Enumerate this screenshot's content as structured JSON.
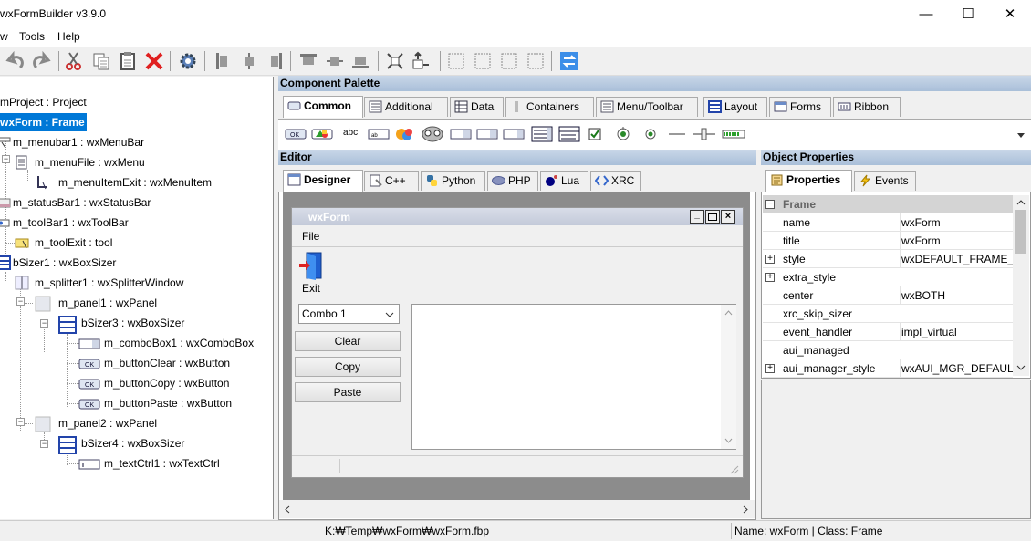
{
  "window": {
    "title": "wxFormBuilder v3.9.0",
    "minimize": "—",
    "maximize": "☐",
    "close": "✕"
  },
  "menubar": {
    "items": [
      "w",
      "Tools",
      "Help"
    ]
  },
  "tree": {
    "items": [
      {
        "label": "mProject : Project"
      },
      {
        "label": "wxForm : Frame"
      },
      {
        "label": "m_menubar1 : wxMenuBar"
      },
      {
        "label": "m_menuFile : wxMenu"
      },
      {
        "label": "m_menuItemExit : wxMenuItem"
      },
      {
        "label": "m_statusBar1 : wxStatusBar"
      },
      {
        "label": "m_toolBar1 : wxToolBar"
      },
      {
        "label": "m_toolExit : tool"
      },
      {
        "label": "bSizer1 : wxBoxSizer"
      },
      {
        "label": "m_splitter1 : wxSplitterWindow"
      },
      {
        "label": "m_panel1 : wxPanel"
      },
      {
        "label": "bSizer3 : wxBoxSizer"
      },
      {
        "label": "m_comboBox1 : wxComboBox"
      },
      {
        "label": "m_buttonClear : wxButton"
      },
      {
        "label": "m_buttonCopy : wxButton"
      },
      {
        "label": "m_buttonPaste : wxButton"
      },
      {
        "label": "m_panel2 : wxPanel"
      },
      {
        "label": "bSizer4 : wxBoxSizer"
      },
      {
        "label": "m_textCtrl1 : wxTextCtrl"
      }
    ]
  },
  "palette": {
    "title": "Component Palette",
    "tabs": [
      "Common",
      "Additional",
      "Data",
      "Containers",
      "Menu/Toolbar",
      "Layout",
      "Forms",
      "Ribbon"
    ],
    "text_widget": "abc"
  },
  "editor": {
    "title": "Editor",
    "tabs": [
      "Designer",
      "C++",
      "Python",
      "PHP",
      "Lua",
      "XRC"
    ]
  },
  "form": {
    "title": "wxForm",
    "menu": "File",
    "tool_label": "Exit",
    "combo_value": "Combo 1",
    "buttons": [
      "Clear",
      "Copy",
      "Paste"
    ]
  },
  "properties": {
    "title": "Object Properties",
    "tabs": [
      "Properties",
      "Events"
    ],
    "category": "Frame",
    "rows": [
      {
        "name": "name",
        "value": "wxForm",
        "type": "text"
      },
      {
        "name": "title",
        "value": "wxForm",
        "type": "text"
      },
      {
        "name": "style",
        "value": "wxDEFAULT_FRAME_ST",
        "type": "text",
        "expand": true
      },
      {
        "name": "extra_style",
        "value": "",
        "type": "text",
        "expand": true
      },
      {
        "name": "center",
        "value": "wxBOTH",
        "type": "text"
      },
      {
        "name": "xrc_skip_sizer",
        "value": "",
        "type": "check",
        "checked": true
      },
      {
        "name": "event_handler",
        "value": "impl_virtual",
        "type": "text"
      },
      {
        "name": "aui_managed",
        "value": "",
        "type": "check",
        "checked": false
      },
      {
        "name": "aui_manager_style",
        "value": "wxAUI_MGR_DEFAULT",
        "type": "text",
        "expand": true
      }
    ]
  },
  "status": {
    "path": "K:₩Temp₩wxForm₩wxForm.fbp",
    "info": "Name: wxForm | Class: Frame"
  }
}
